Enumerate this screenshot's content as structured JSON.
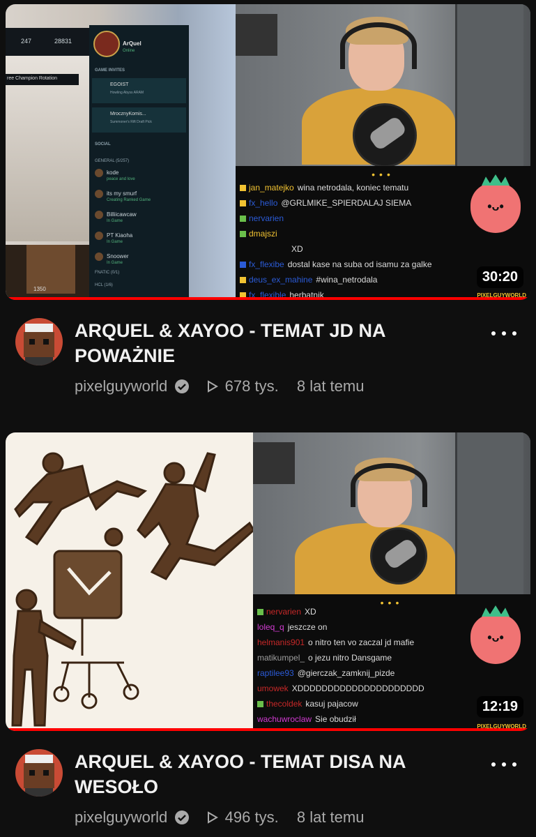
{
  "videos": [
    {
      "title": "ARQUEL & XAYOO - TEMAT JD NA POWAŻNIE",
      "channel": "pixelguyworld",
      "views": "678 tys.",
      "age": "8 lat temu",
      "duration": "30:20",
      "progress_fraction": 1.0,
      "thumb_game": {
        "champion_rotation": "ree Champion Rotation",
        "currency_1": "247",
        "currency_2": "28831",
        "player_name": "ArQuel",
        "player_status": "Online",
        "section_invites": "GAME INVITES",
        "invites": [
          {
            "name": "EGOIST",
            "detail": "Howling Abyss ARAM"
          },
          {
            "name": "MrocznyKomis...",
            "detail": "Summoner's Rift Draft Pick"
          }
        ],
        "section_social": "SOCIAL",
        "group_general": "GENERAL (5/257)",
        "friends": [
          {
            "name": "kode",
            "status": "peace and love"
          },
          {
            "name": "its my smurf",
            "status": "Creating Ranked Game"
          },
          {
            "name": "Billiicawcaw",
            "status": "In Game"
          },
          {
            "name": "PT Kiaoha",
            "status": "In Game"
          },
          {
            "name": "Snoower",
            "status": "In Game"
          }
        ],
        "group_fnatic": "FNATIC (0/1)",
        "group_hcl": "HCL (1/6)",
        "bottom_value": "1350"
      },
      "chat": [
        {
          "user": "jan_matejko",
          "text": "wina netrodala, koniec tematu",
          "color": "#f1c232"
        },
        {
          "user": "fx_hello",
          "text": "@GRLMIKE_SPIERDALAJ SIEMA",
          "color": "#2b5bd7"
        },
        {
          "user": "nervarien",
          "text": "",
          "color": "#2b5bd7"
        },
        {
          "user": "dmajszi",
          "text": "",
          "color": "#f1c232"
        },
        {
          "user": "",
          "text": "XD",
          "color": "#f1c232"
        },
        {
          "user": "fx_flexibe",
          "text": "dostal kase na suba od isamu za galke",
          "color": "#2b5bd7"
        },
        {
          "user": "deus_ex_mahine",
          "text": "#wina_netrodala",
          "color": "#2b5bd7"
        },
        {
          "user": "fx_flexible",
          "text": "herbatnik",
          "color": "#2b5bd7"
        }
      ],
      "watermark": "PIXELGUYWORLD"
    },
    {
      "title": "ARQUEL & XAYOO - TEMAT DISA NA WESOŁO",
      "channel": "pixelguyworld",
      "views": "496 tys.",
      "age": "8 lat temu",
      "duration": "12:19",
      "progress_fraction": 1.0,
      "chat": [
        {
          "user": "nervarien",
          "text": "XD",
          "color": "#c62828"
        },
        {
          "user": "loleq_q",
          "text": "jeszcze on",
          "color": "#d23bd2"
        },
        {
          "user": "helmanis901",
          "text": "o nitro ten vo zaczal jd mafie",
          "color": "#c62828"
        },
        {
          "user": "matikumpel_",
          "text": "o jezu nitro Dansgame",
          "color": "#9e9e9e"
        },
        {
          "user": "raptilee93",
          "text": "@gierczak_zamknij_pizde",
          "color": "#2b5bd7"
        },
        {
          "user": "umowek",
          "text": "XDDDDDDDDDDDDDDDDDDDDD",
          "color": "#c62828"
        },
        {
          "user": "thecoldek",
          "text": "kasuj pajacow",
          "color": "#c62828"
        },
        {
          "user": "wachuwroclaw",
          "text": "Sie obudził",
          "color": "#d23bd2"
        }
      ],
      "watermark": "PIXELGUYWORLD"
    }
  ],
  "colors": {
    "background": "#0f0f0f",
    "progress": "#ff0000",
    "meta_text": "#aaaaaa"
  },
  "icons": [
    "more-vert-icon",
    "verified-check-icon",
    "play-views-icon"
  ]
}
